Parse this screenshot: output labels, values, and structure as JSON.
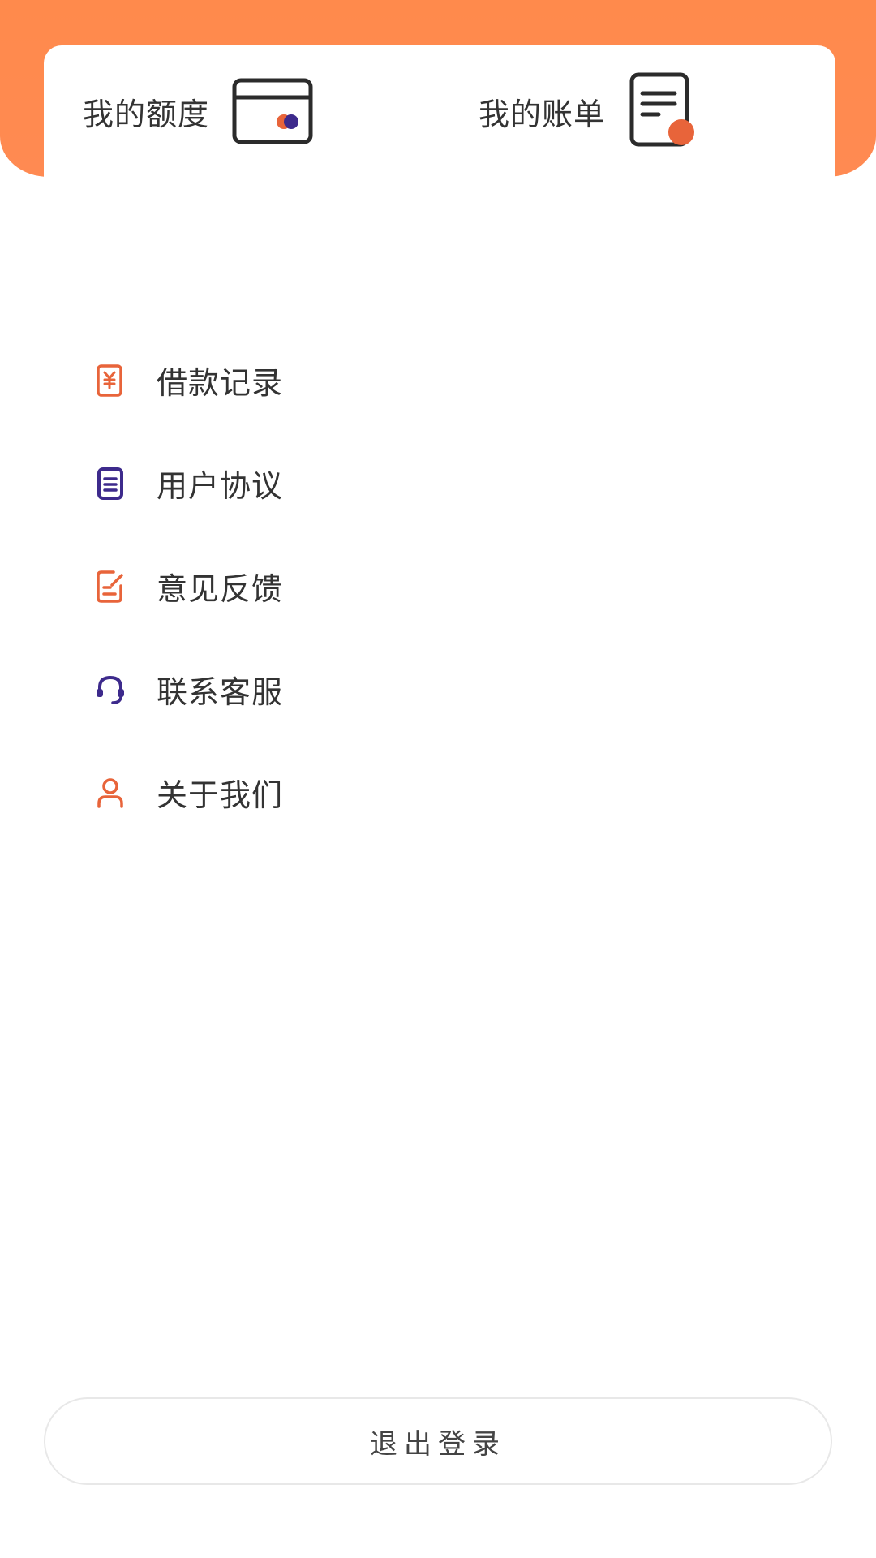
{
  "colors": {
    "header_orange": "#ff8a4c",
    "icon_orange": "#e8643a",
    "icon_purple": "#3d2a8c",
    "text": "#333333"
  },
  "quick_actions": [
    {
      "label": "我的额度",
      "icon": "card-icon"
    },
    {
      "label": "我的账单",
      "icon": "bill-document-icon"
    }
  ],
  "menu": [
    {
      "label": "借款记录",
      "icon": "loan-record-icon"
    },
    {
      "label": "用户协议",
      "icon": "document-icon"
    },
    {
      "label": "意见反馈",
      "icon": "feedback-edit-icon"
    },
    {
      "label": "联系客服",
      "icon": "headset-icon"
    },
    {
      "label": "关于我们",
      "icon": "user-icon"
    }
  ],
  "logout_label": "退出登录"
}
